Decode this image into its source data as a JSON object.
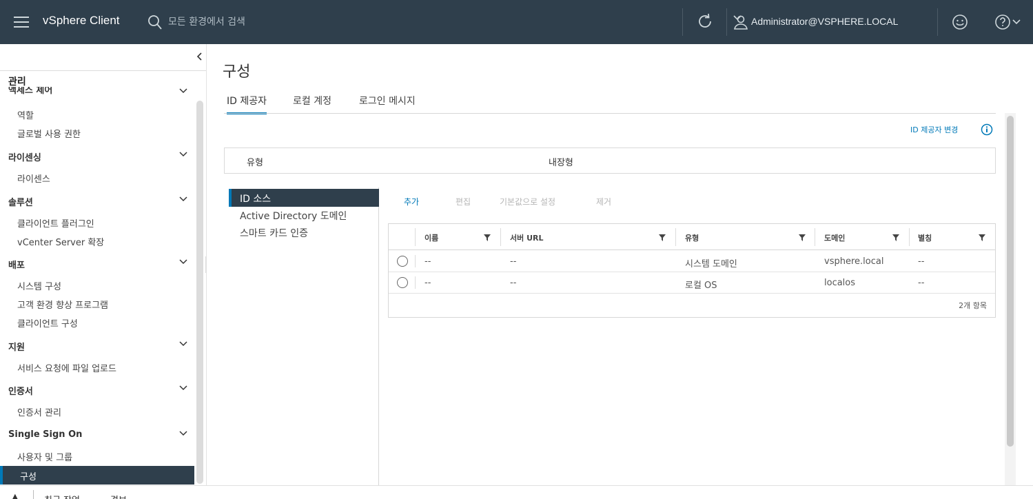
{
  "header": {
    "brand": "vSphere Client",
    "search_placeholder": "모든 환경에서 검색",
    "user": "Administrator@VSPHERE.LOCAL"
  },
  "sidebar": {
    "title": "관리",
    "groups": [
      {
        "label": "액세스 제어",
        "items": [
          "역할",
          "글로벌 사용 권한"
        ]
      },
      {
        "label": "라이센싱",
        "items": [
          "라이센스"
        ]
      },
      {
        "label": "솔루션",
        "items": [
          "클라이언트 플러그인",
          "vCenter Server 확장"
        ]
      },
      {
        "label": "배포",
        "items": [
          "시스템 구성",
          "고객 환경 향상 프로그램",
          "클라이언트 구성"
        ]
      },
      {
        "label": "지원",
        "items": [
          "서비스 요청에 파일 업로드"
        ]
      },
      {
        "label": "인증서",
        "items": [
          "인증서 관리"
        ]
      },
      {
        "label": "Single Sign On",
        "items": [
          "사용자 및 그룹",
          "구성"
        ]
      }
    ]
  },
  "main": {
    "title": "구성",
    "tabs": [
      "ID 제공자",
      "로컬 계정",
      "로그인 메시지"
    ],
    "change_provider": "ID 제공자 변경",
    "type_label": "유형",
    "type_value": "내장형",
    "vnav": [
      "ID 소스",
      "Active Directory 도메인",
      "스마트 카드 인증"
    ],
    "actions": [
      "추가",
      "편집",
      "기본값으로 설정",
      "제거"
    ],
    "grid": {
      "columns": [
        "이름",
        "서버 URL",
        "유형",
        "도메인",
        "별칭"
      ],
      "rows": [
        [
          "--",
          "--",
          "시스템 도메인",
          "vsphere.local",
          "--"
        ],
        [
          "--",
          "--",
          "로컬 OS",
          "localos",
          "--"
        ]
      ],
      "count": "2개 항목"
    }
  },
  "bottom": {
    "recent_tasks": "최근 작업",
    "alarms": "경보"
  }
}
